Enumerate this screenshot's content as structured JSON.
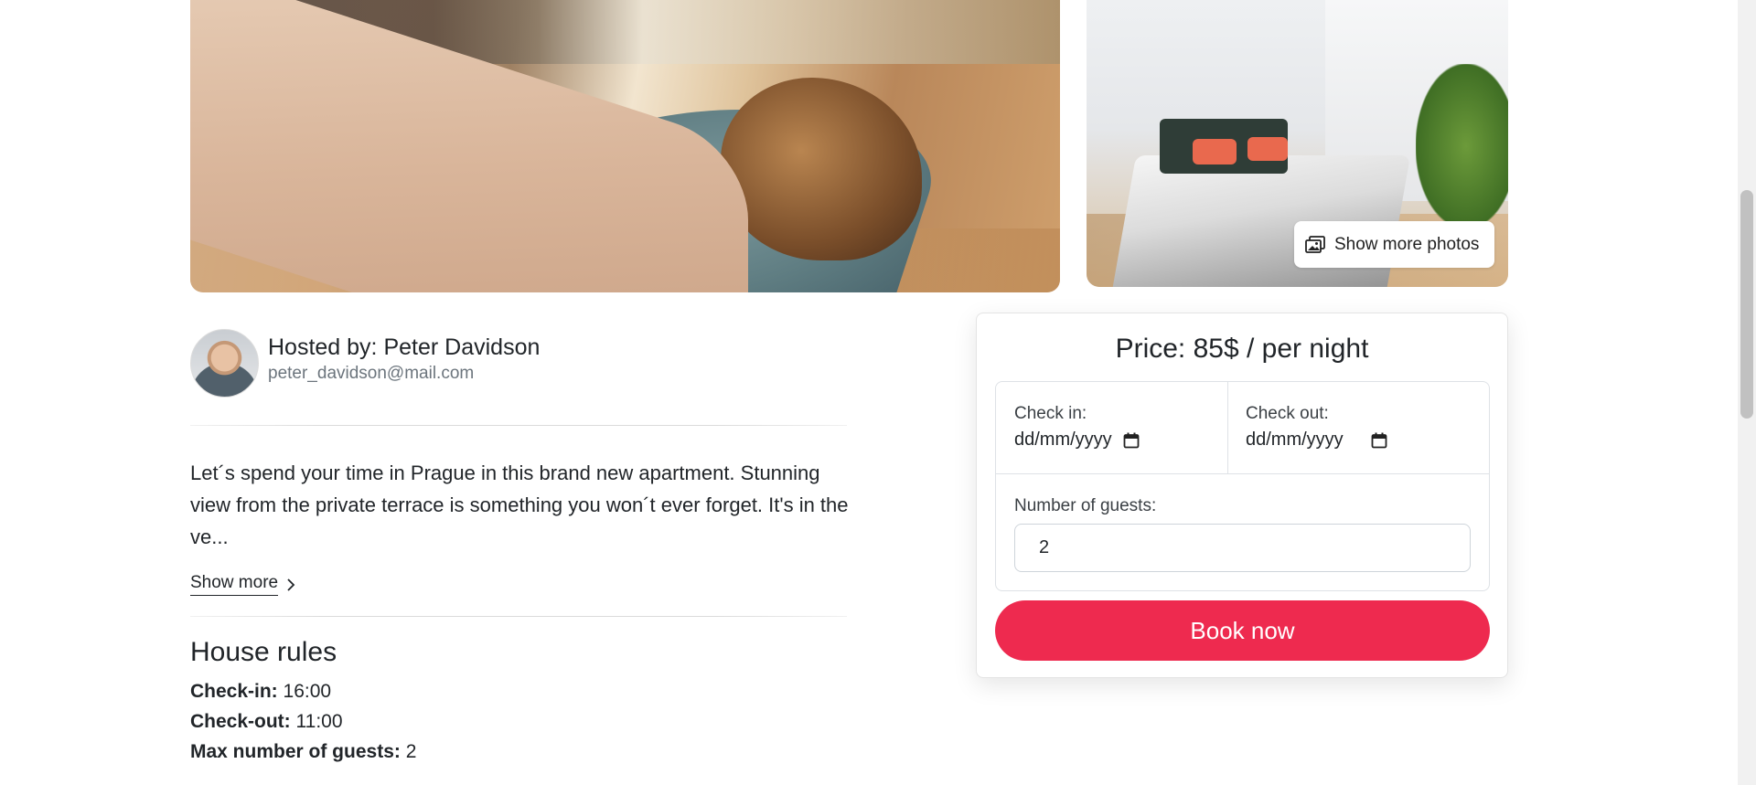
{
  "gallery": {
    "show_more_photos_label": "Show more photos"
  },
  "host": {
    "title": "Hosted by: Peter Davidson",
    "email": "peter_davidson@mail.com"
  },
  "listing": {
    "description": "Let´s spend your time in Prague in this brand new apartment. Stunning view from the private terrace is something you won´t ever forget. It's in the ve...",
    "show_more_label": "Show more"
  },
  "house_rules": {
    "title": "House rules",
    "items": [
      {
        "label": "Check-in:",
        "value": "16:00"
      },
      {
        "label": "Check-out:",
        "value": "11:00"
      },
      {
        "label": "Max number of guests:",
        "value": "2"
      }
    ]
  },
  "booking": {
    "price_text": "Price: 85$ / per night",
    "check_in_label": "Check in:",
    "check_in_value": "dd/mm/yyyy",
    "check_out_label": "Check out:",
    "check_out_value": "dd/mm/yyyy",
    "guests_label": "Number of guests:",
    "guests_value": "2",
    "book_button_label": "Book now"
  },
  "colors": {
    "accent": "#ee2a4f",
    "text": "#212529",
    "muted": "#6c757d"
  }
}
